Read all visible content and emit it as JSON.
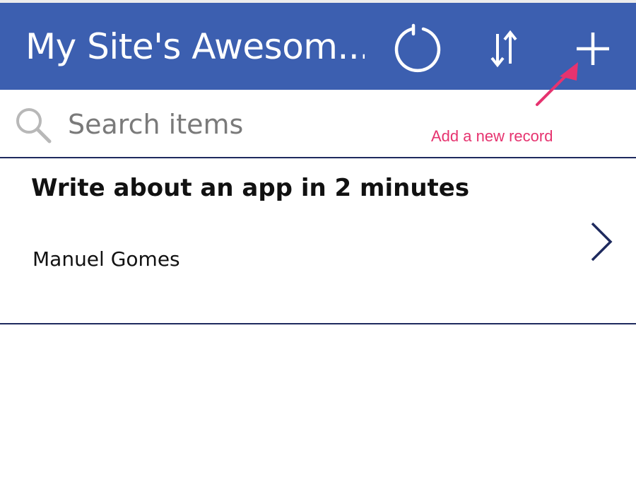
{
  "header": {
    "title": "My Site's Awesom...",
    "background_color": "#3c5fb0",
    "actions": [
      {
        "icon": "refresh-icon"
      },
      {
        "icon": "sort-icon"
      },
      {
        "icon": "add-icon"
      }
    ]
  },
  "search": {
    "placeholder": "Search items",
    "value": "",
    "icon": "search-icon"
  },
  "annotation": {
    "text": "Add a new record",
    "color": "#e6336f"
  },
  "items": [
    {
      "title": "Write about an app in 2 minutes",
      "subtitle": "Manuel Gomes",
      "icon": "chevron-right-icon"
    }
  ]
}
